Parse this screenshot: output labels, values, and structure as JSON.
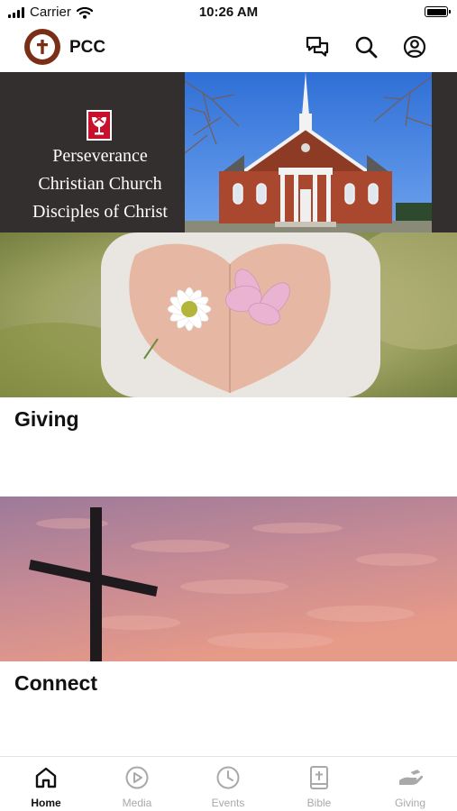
{
  "status_bar": {
    "carrier": "Carrier",
    "time": "10:26 AM"
  },
  "header": {
    "app_title": "PCC"
  },
  "banner": {
    "lines": [
      "Perseverance",
      "Christian Church",
      "Disciples of Christ"
    ]
  },
  "cards": [
    {
      "title": "Giving"
    },
    {
      "title": "Connect"
    }
  ],
  "tab_bar": {
    "items": [
      {
        "label": "Home",
        "icon": "home-icon",
        "active": true
      },
      {
        "label": "Media",
        "icon": "play-icon",
        "active": false
      },
      {
        "label": "Events",
        "icon": "clock-icon",
        "active": false
      },
      {
        "label": "Bible",
        "icon": "bible-icon",
        "active": false
      },
      {
        "label": "Giving",
        "icon": "giving-hand-icon",
        "active": false
      }
    ]
  },
  "colors": {
    "logo": "#7a2e16",
    "banner_bg": "#332f2e",
    "tab_active": "#111111",
    "tab_inactive": "#a9a9a9"
  }
}
